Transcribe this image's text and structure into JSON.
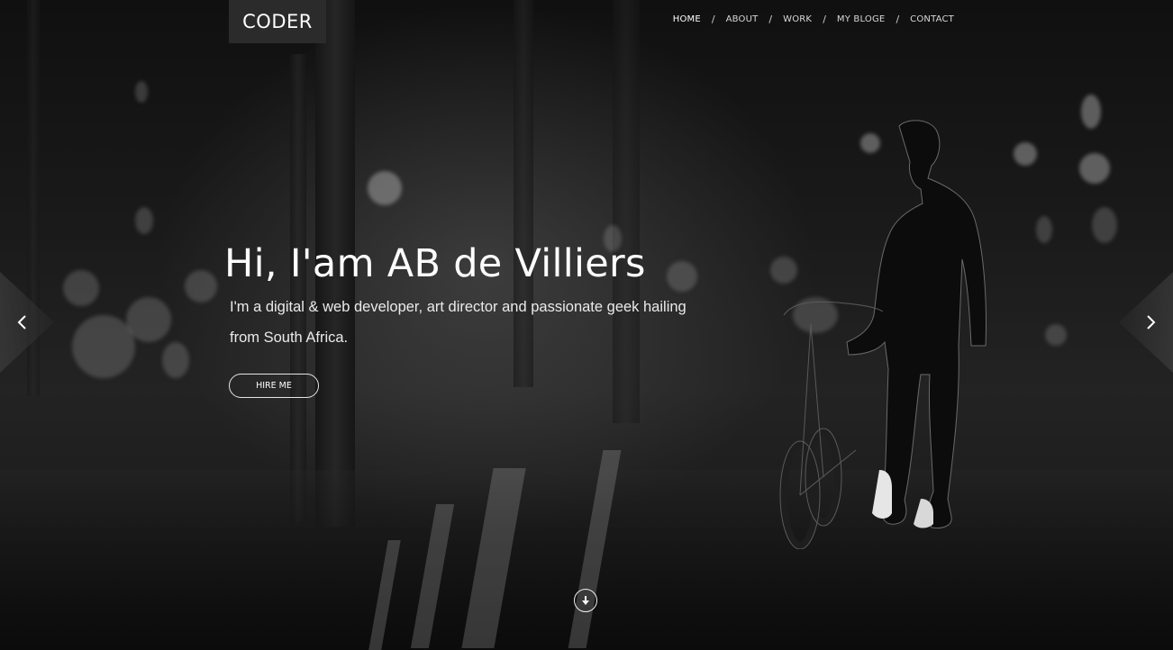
{
  "header": {
    "logo": "CODER",
    "nav": [
      {
        "label": "HOME",
        "active": true
      },
      {
        "label": "ABOUT",
        "active": false
      },
      {
        "label": "WORK",
        "active": false
      },
      {
        "label": "MY BLOGE",
        "active": false
      },
      {
        "label": "CONTACT",
        "active": false
      }
    ],
    "separator": "/"
  },
  "hero": {
    "title": "Hi, I'am AB de Villiers",
    "subtitle": "I'm a digital & web developer, art director and passionate geek hailing from South Africa.",
    "button_label": "HIRE ME"
  },
  "icons": {
    "prev": "chevron-left-icon",
    "next": "chevron-right-icon",
    "scroll": "arrow-down-circle-icon"
  },
  "colors": {
    "overlay": "#0b0b0b",
    "text": "#ffffff",
    "logo_bg": "#2b2b2b"
  }
}
